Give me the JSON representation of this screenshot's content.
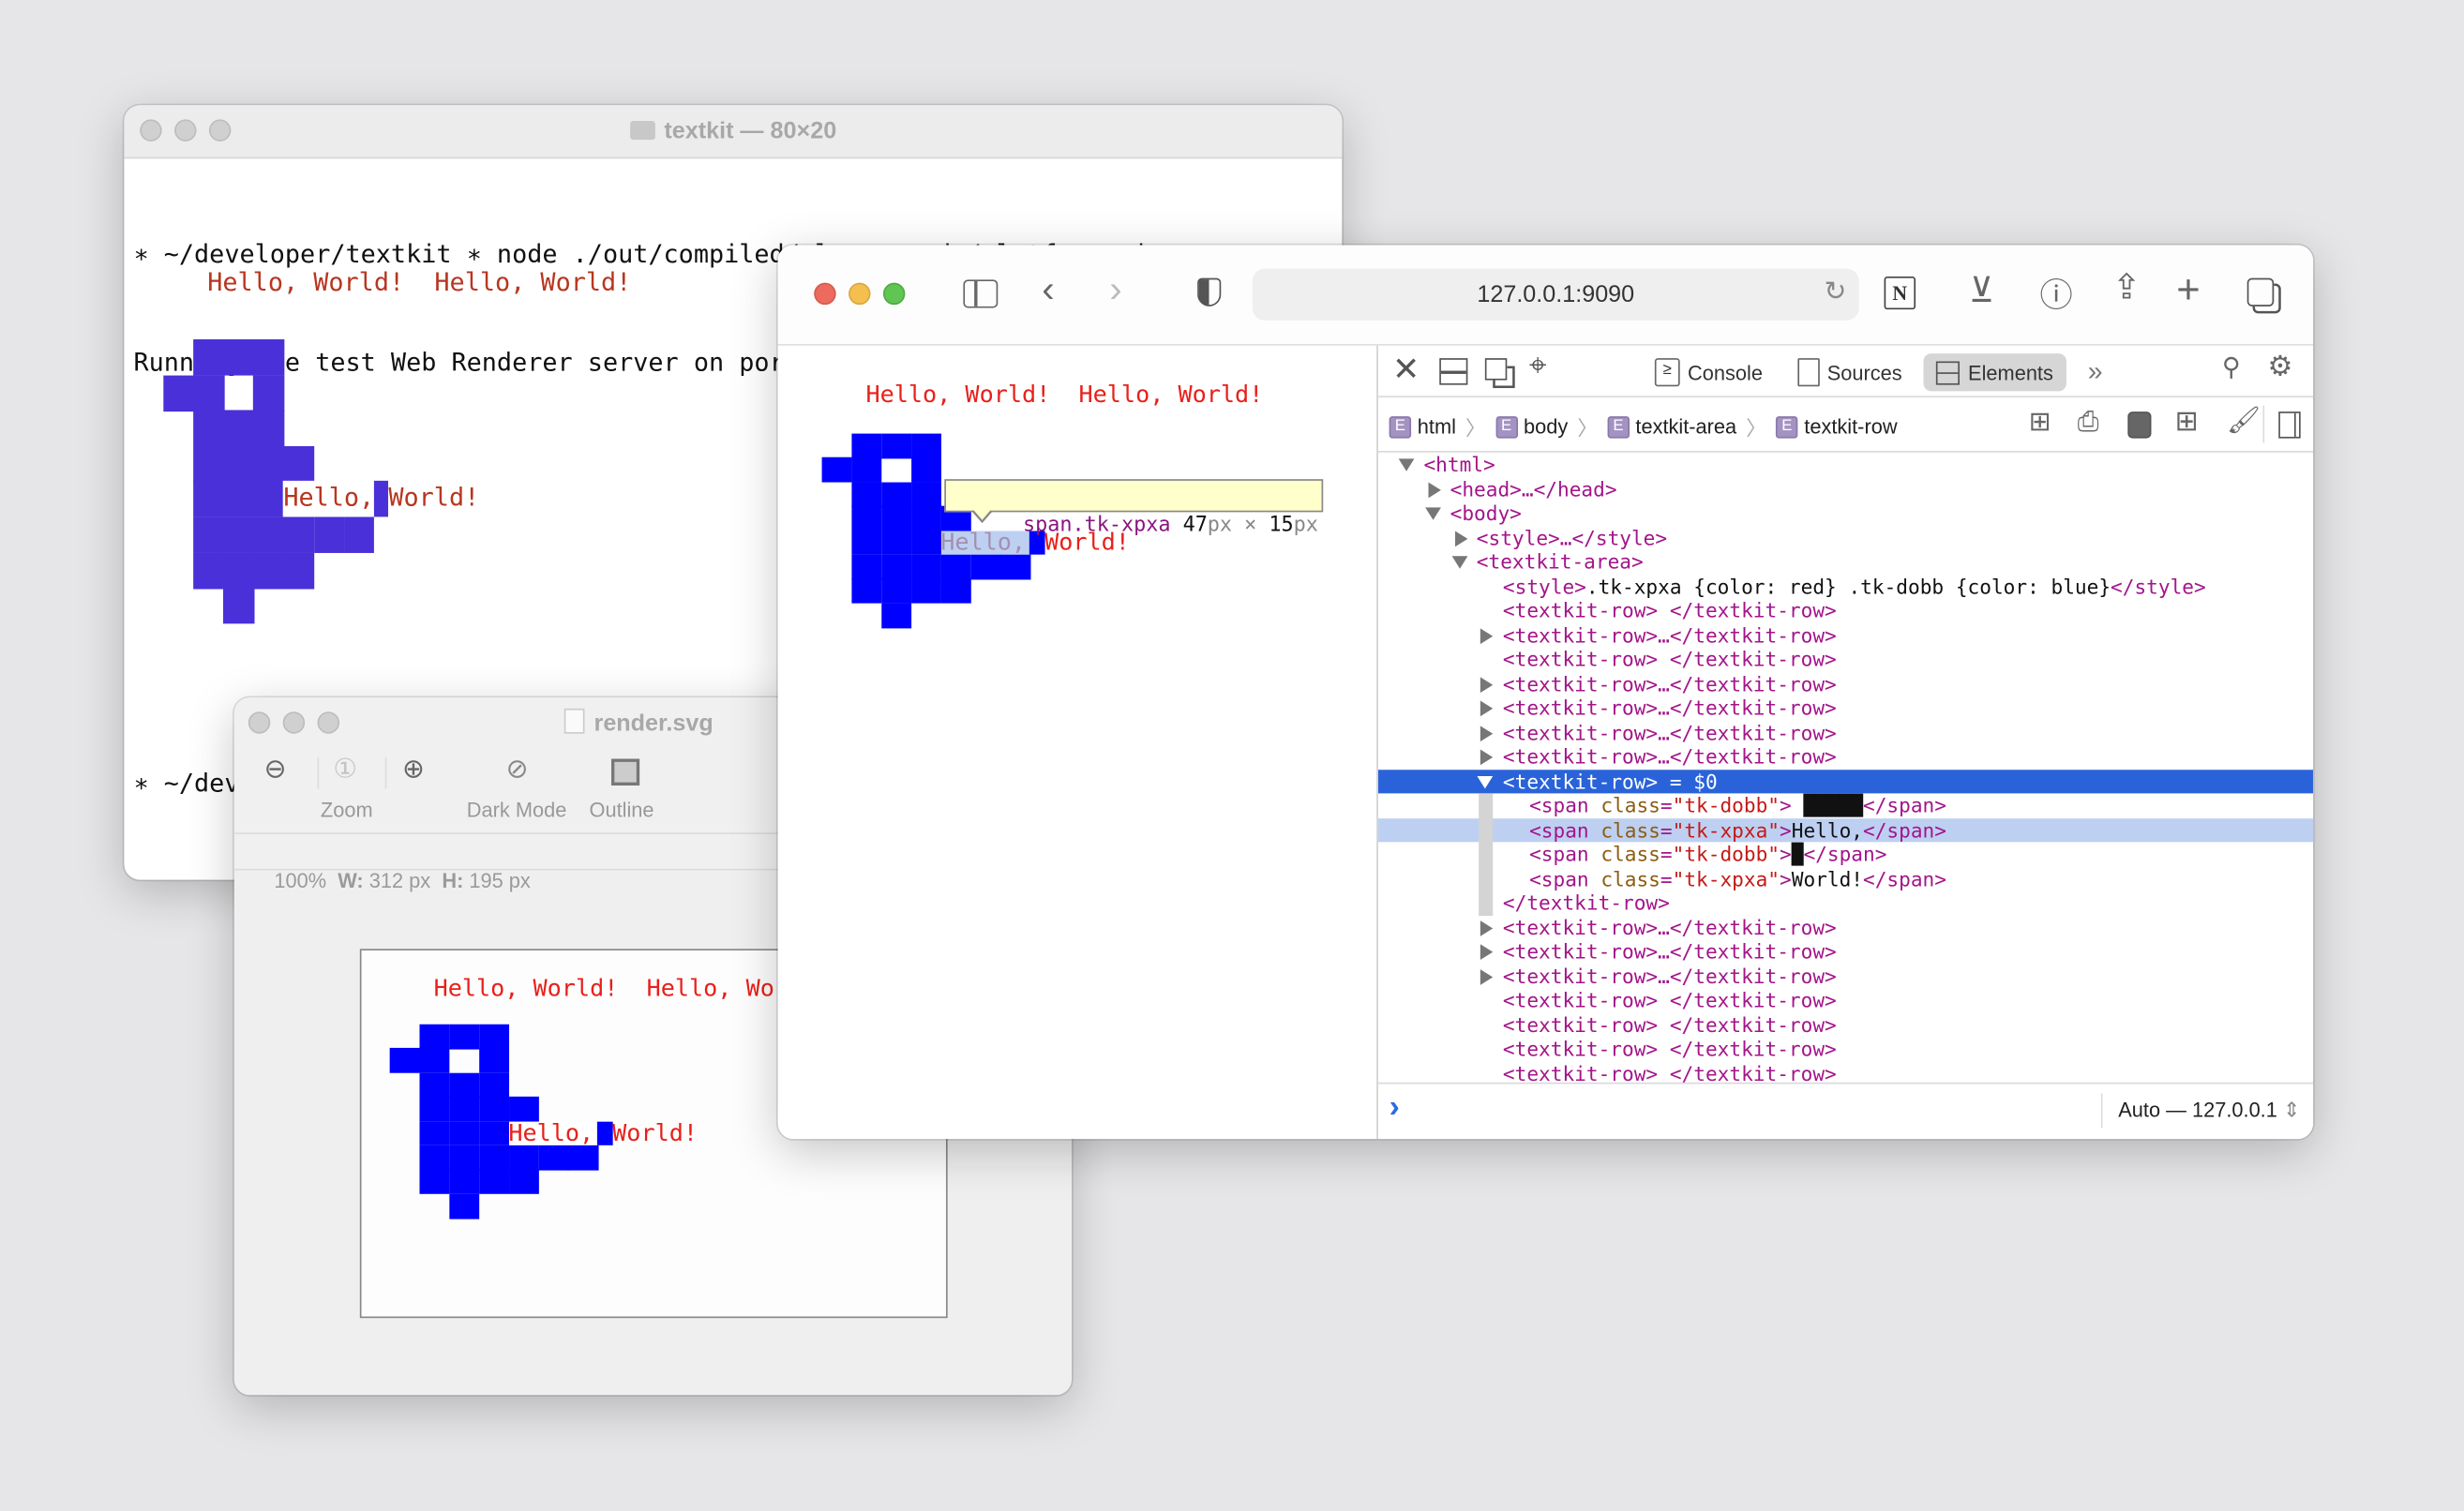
{
  "terminal": {
    "title": "textkit — 80×20",
    "lines": [
      "∗ ~/developer/textkit ∗ node ./out/compiled/playgrounds/platforms.js",
      "Running the test Web Renderer server on port 9090, rendering:"
    ],
    "prompt_partial": "∗ ~/dev",
    "render": {
      "header": "Hello, World!  Hello, World!",
      "hello": "Hello,",
      "world": "World!"
    }
  },
  "svg_viewer": {
    "title": "render.svg",
    "toolbar": {
      "zoom_label": "Zoom",
      "dark_mode_label": "Dark Mode",
      "outline_label": "Outline"
    },
    "status": {
      "zoom": "100%",
      "w_label": "W:",
      "w_value": "312 px",
      "h_label": "H:",
      "h_value": "195 px"
    },
    "render": {
      "header": "Hello, World!  Hello, Wo",
      "hello": "Hello,",
      "world": "World!"
    }
  },
  "browser": {
    "url": "127.0.0.1:9090",
    "page": {
      "header": "Hello, World!  Hello, World!",
      "hello": "Hello,",
      "world": "World!"
    },
    "tooltip": {
      "selector": "span.tk-xpxa",
      "width": "47",
      "x": "×",
      "height": "15",
      "unit": "px"
    },
    "devtools": {
      "tabs": [
        {
          "label": "Console",
          "icon": "console-icon",
          "active": false
        },
        {
          "label": "Sources",
          "icon": "document-icon",
          "active": false
        },
        {
          "label": "Elements",
          "icon": "elements-icon",
          "active": true
        }
      ],
      "more": "»",
      "breadcrumbs": [
        "html",
        "body",
        "textkit-area",
        "textkit-row"
      ],
      "badge": "E",
      "dom": [
        {
          "indent": 0,
          "arrow": "open",
          "parts": [
            [
              "tg",
              "<html>"
            ]
          ]
        },
        {
          "indent": 1,
          "arrow": "closed",
          "parts": [
            [
              "tg",
              "<head>…</head>"
            ]
          ]
        },
        {
          "indent": 1,
          "arrow": "open",
          "parts": [
            [
              "tg",
              "<body>"
            ]
          ]
        },
        {
          "indent": 2,
          "arrow": "closed",
          "parts": [
            [
              "tg",
              "<style>…</style>"
            ]
          ]
        },
        {
          "indent": 2,
          "arrow": "open",
          "parts": [
            [
              "tg",
              "<textkit-area>"
            ]
          ]
        },
        {
          "indent": 3,
          "arrow": "",
          "parts": [
            [
              "tg",
              "<style>"
            ],
            [
              "tx",
              ".tk-xpxa {color: red} .tk-dobb {color: blue}"
            ],
            [
              "tg",
              "</style>"
            ]
          ]
        },
        {
          "indent": 3,
          "arrow": "",
          "parts": [
            [
              "tg",
              "<textkit-row> </textkit-row>"
            ]
          ]
        },
        {
          "indent": 3,
          "arrow": "closed",
          "parts": [
            [
              "tg",
              "<textkit-row>…</textkit-row>"
            ]
          ]
        },
        {
          "indent": 3,
          "arrow": "",
          "parts": [
            [
              "tg",
              "<textkit-row> </textkit-row>"
            ]
          ]
        },
        {
          "indent": 3,
          "arrow": "closed",
          "parts": [
            [
              "tg",
              "<textkit-row>…</textkit-row>"
            ]
          ]
        },
        {
          "indent": 3,
          "arrow": "closed",
          "parts": [
            [
              "tg",
              "<textkit-row>…</textkit-row>"
            ]
          ]
        },
        {
          "indent": 3,
          "arrow": "closed",
          "parts": [
            [
              "tg",
              "<textkit-row>…</textkit-row>"
            ]
          ]
        },
        {
          "indent": 3,
          "arrow": "closed",
          "parts": [
            [
              "tg",
              "<textkit-row>…</textkit-row>"
            ]
          ]
        },
        {
          "indent": 3,
          "arrow": "open",
          "selected": true,
          "parts": [
            [
              "tg",
              "<textkit-row>"
            ],
            [
              "tx",
              " = $0"
            ]
          ]
        },
        {
          "indent": 4,
          "arrow": "",
          "parts": [
            [
              "tg",
              "<span "
            ],
            [
              "at",
              "class"
            ],
            [
              "tg",
              "="
            ],
            [
              "av",
              "\"tk-dobb\""
            ],
            [
              "tg",
              "> "
            ],
            [
              "tx",
              "█████"
            ],
            [
              "tg",
              "</span>"
            ]
          ]
        },
        {
          "indent": 4,
          "arrow": "",
          "hover": true,
          "parts": [
            [
              "tg",
              "<span "
            ],
            [
              "at",
              "class"
            ],
            [
              "tg",
              "="
            ],
            [
              "av",
              "\"tk-xpxa\""
            ],
            [
              "tg",
              ">"
            ],
            [
              "tx",
              "Hello,"
            ],
            [
              "tg",
              "</span>"
            ]
          ]
        },
        {
          "indent": 4,
          "arrow": "",
          "parts": [
            [
              "tg",
              "<span "
            ],
            [
              "at",
              "class"
            ],
            [
              "tg",
              "="
            ],
            [
              "av",
              "\"tk-dobb\""
            ],
            [
              "tg",
              ">"
            ],
            [
              "tx",
              "█"
            ],
            [
              "tg",
              "</span>"
            ]
          ]
        },
        {
          "indent": 4,
          "arrow": "",
          "parts": [
            [
              "tg",
              "<span "
            ],
            [
              "at",
              "class"
            ],
            [
              "tg",
              "="
            ],
            [
              "av",
              "\"tk-xpxa\""
            ],
            [
              "tg",
              ">"
            ],
            [
              "tx",
              "World!"
            ],
            [
              "tg",
              "</span>"
            ]
          ]
        },
        {
          "indent": 3,
          "arrow": "",
          "parts": [
            [
              "tg",
              "</textkit-row>"
            ]
          ]
        },
        {
          "indent": 3,
          "arrow": "closed",
          "parts": [
            [
              "tg",
              "<textkit-row>…</textkit-row>"
            ]
          ]
        },
        {
          "indent": 3,
          "arrow": "closed",
          "parts": [
            [
              "tg",
              "<textkit-row>…</textkit-row>"
            ]
          ]
        },
        {
          "indent": 3,
          "arrow": "closed",
          "parts": [
            [
              "tg",
              "<textkit-row>…</textkit-row>"
            ]
          ]
        },
        {
          "indent": 3,
          "arrow": "",
          "parts": [
            [
              "tg",
              "<textkit-row> </textkit-row>"
            ]
          ]
        },
        {
          "indent": 3,
          "arrow": "",
          "parts": [
            [
              "tg",
              "<textkit-row> </textkit-row>"
            ]
          ]
        },
        {
          "indent": 3,
          "arrow": "",
          "parts": [
            [
              "tg",
              "<textkit-row> </textkit-row>"
            ]
          ]
        },
        {
          "indent": 3,
          "arrow": "",
          "parts": [
            [
              "tg",
              "<textkit-row> </textkit-row>"
            ]
          ]
        }
      ],
      "console_prompt": "›",
      "context": "Auto — 127.0.0.1"
    }
  },
  "colors": {
    "terminal_bird": "#4a30d8",
    "terminal_text": "#b8361f",
    "browser_bird": "#0000ff",
    "browser_text": "#e8201a",
    "selection": "#2a63d9",
    "hover": "#bdd0f2"
  }
}
